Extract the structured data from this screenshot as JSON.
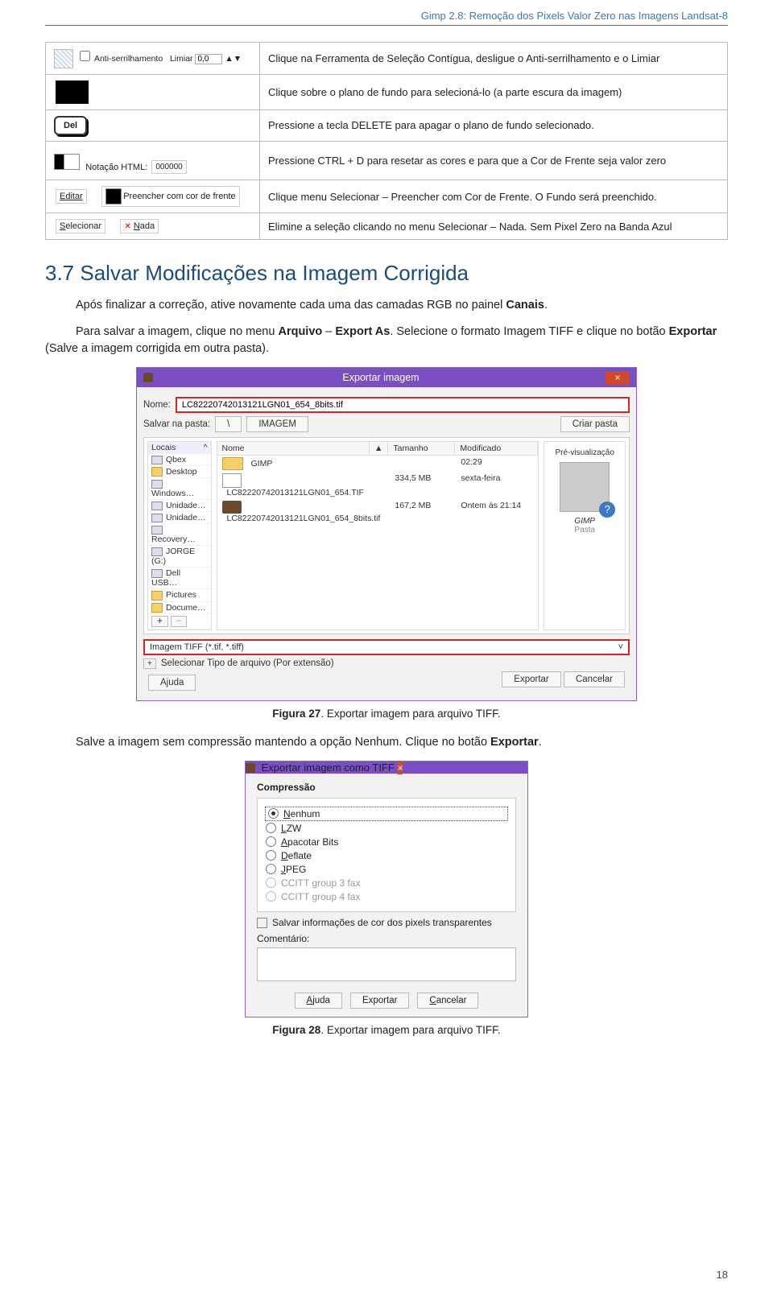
{
  "header": {
    "title": "Gimp 2.8: Remoção dos Pixels Valor Zero nas Imagens Landsat-8"
  },
  "table": {
    "r1": {
      "antialias": "Anti-serrilhamento",
      "limiar": "Limiar",
      "thresh": "0,0",
      "desc": "Clique na Ferramenta de Seleção Contígua, desligue o Anti-serrilhamento e o Limiar"
    },
    "r2": {
      "desc": "Clique sobre o plano de fundo para selecioná-lo (a parte escura da imagem)"
    },
    "r3": {
      "key": "Del",
      "desc": "Pressione a tecla DELETE para apagar o plano de fundo selecionado."
    },
    "r4": {
      "label": "Notação HTML:",
      "val": "000000",
      "desc": "Pressione CTRL + D para resetar as cores e para que a Cor de Frente seja valor zero"
    },
    "r5": {
      "editar": "Editar",
      "fill": "Preencher com cor de frente",
      "desc": "Clique menu Selecionar – Preencher com Cor de Frente. O Fundo será preenchido."
    },
    "r6": {
      "sel": "elecionar",
      "nada": "ada",
      "desc": "Elimine a seleção clicando no menu Selecionar – Nada. Sem Pixel Zero na Banda Azul"
    }
  },
  "section": {
    "h2": "3.7 Salvar Modificações na Imagem Corrigida",
    "p1a": "Após finalizar a correção, ative novamente cada uma das camadas RGB no painel",
    "p1b": "Canais",
    "p2a": "Para salvar a imagem, clique no menu",
    "p2b": "Arquivo",
    "p2c": "Export As",
    "p2d": "Selecione o formato Imagem TIFF e clique no botão",
    "p2e": "Exportar",
    "p2f": "(Salve a imagem corrigida em outra pasta).",
    "p3a": "Salve a imagem sem compressão mantendo a opção Nenhum. Clique no botão",
    "p3b": "Exportar"
  },
  "dlg1": {
    "title": "Exportar imagem",
    "nomeLbl": "Nome:",
    "filename": "LC82220742013121LGN01_654_8bits.tif",
    "salvarPastaLbl": "Salvar na pasta:",
    "pasta": "IMAGEM",
    "criarPasta": "Criar pasta",
    "places": {
      "hdr": "Locais",
      "p0": "Qbex",
      "p1": "Desktop",
      "p2": "Windows…",
      "p3": "Unidade…",
      "p4": "Unidade…",
      "p5": "Recovery…",
      "p6": "JORGE (G:)",
      "p7": "Dell USB…",
      "p8": "Pictures",
      "p9": "Docume…"
    },
    "cols": {
      "nome": "Nome",
      "tam": "Tamanho",
      "mod": "Modificado"
    },
    "files": [
      {
        "n": "GIMP",
        "s": "",
        "m": "02:29"
      },
      {
        "n": "LC82220742013121LGN01_654.TIF",
        "s": "334,5 MB",
        "m": "sexta-feira"
      },
      {
        "n": "LC82220742013121LGN01_654_8bits.tif",
        "s": "167,2 MB",
        "m": "Ontem às 21:14"
      }
    ],
    "previewLbl": "Pré-visualização",
    "previewName": "GIMP",
    "previewKind": "Pasta",
    "filetype": "Imagem TIFF (*.tif, *.tiff)",
    "selType": "Selecionar Tipo de arquivo (Por extensão)",
    "ajuda": "Ajuda",
    "exportar": "Exportar",
    "cancelar": "Cancelar"
  },
  "fig27": {
    "label": "Figura 27",
    "text": "Exportar imagem para arquivo TIFF."
  },
  "dlg2": {
    "title": "Exportar imagem como TIFF",
    "compLabel": "Compressão",
    "opts": [
      "enhum",
      "ZW",
      "pacotar Bits",
      "eflate",
      "PEG",
      "CCITT group 3 fax",
      "CCITT group 4 fax"
    ],
    "saveAlpha": "Salvar informações de cor dos pixels transparentes",
    "comentLabel": "Comentário:",
    "ajuda": "juda",
    "exportar": "Exportar",
    "cancelar": "ancelar"
  },
  "fig28": {
    "label": "Figura 28",
    "text": "Exportar imagem para arquivo TIFF."
  },
  "footer": {
    "page": "18"
  }
}
